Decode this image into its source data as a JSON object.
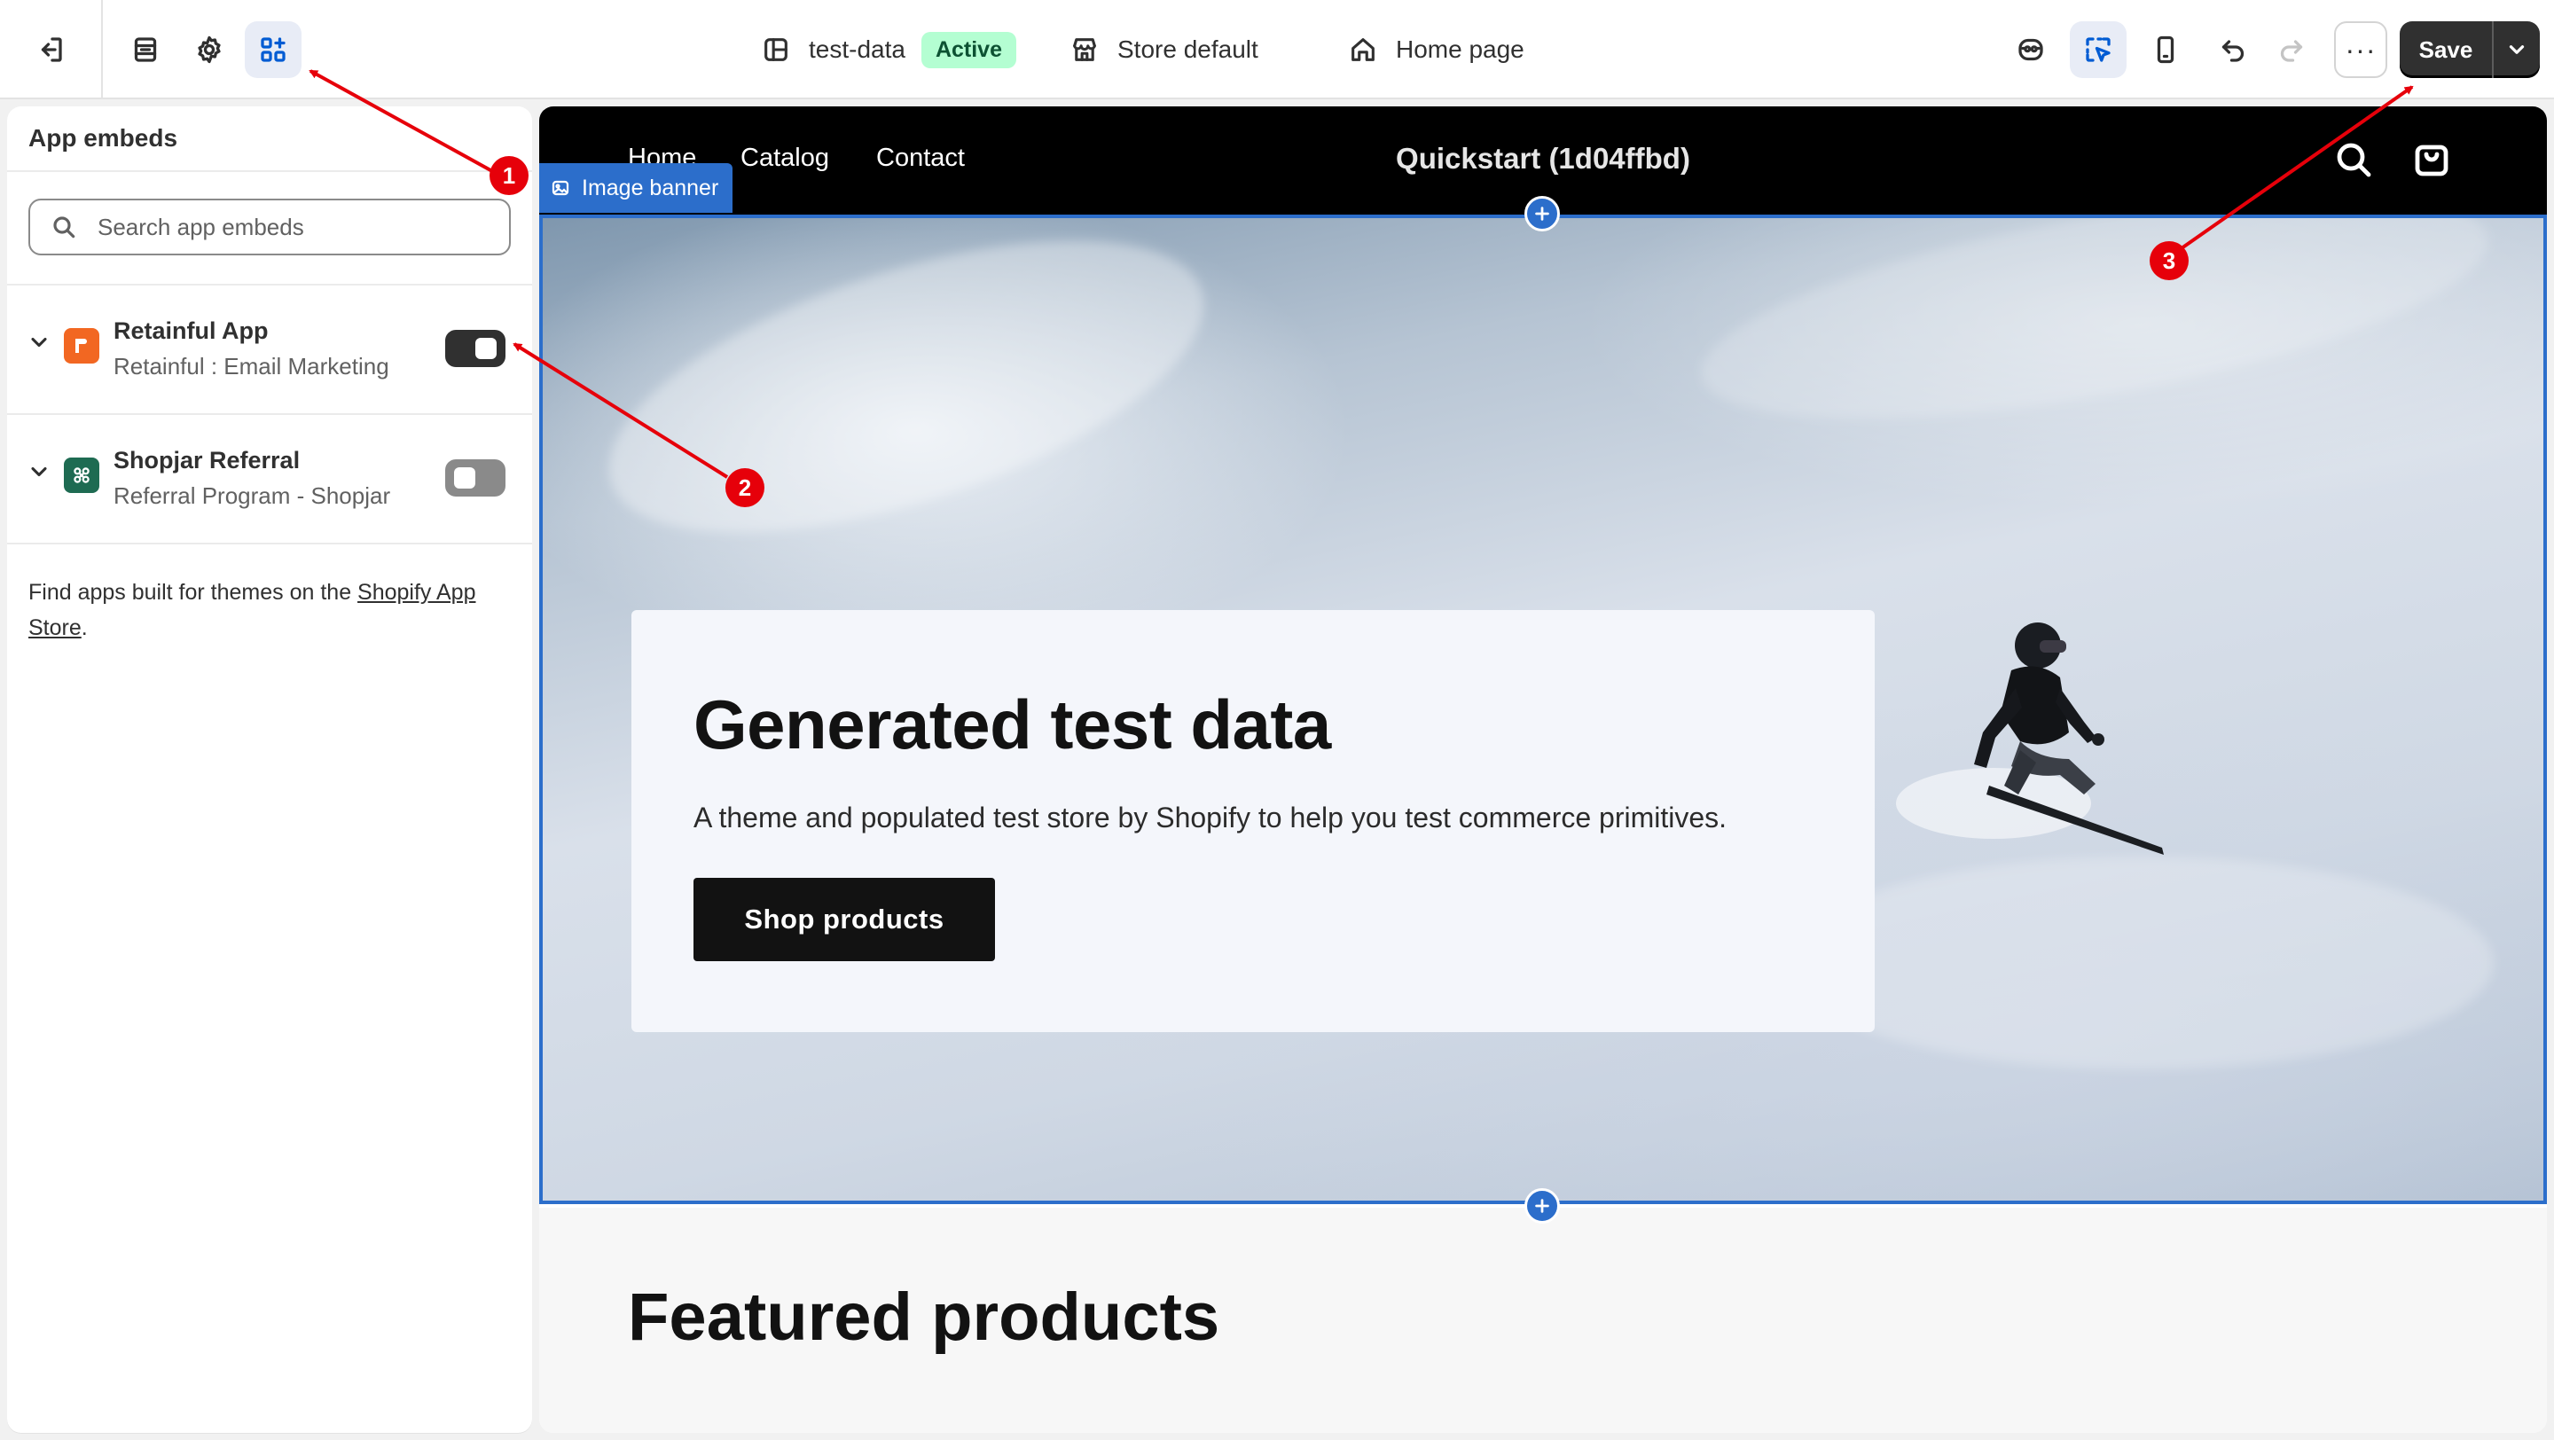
{
  "topbar": {
    "theme_name": "test-data",
    "theme_status": "Active",
    "store_context": "Store default",
    "page_template": "Home page",
    "save_label": "Save",
    "more_label": "···"
  },
  "sidebar": {
    "title": "App embeds",
    "search_placeholder": "Search app embeds",
    "apps": [
      {
        "name": "Retainful App",
        "subtitle": "Retainful : Email Marketing",
        "enabled": true,
        "logo_color": "#f26722"
      },
      {
        "name": "Shopjar Referral",
        "subtitle": "Referral Program - Shopjar",
        "enabled": false,
        "logo_color": "#1e6b52"
      }
    ],
    "footer_text": "Find apps built for themes on the ",
    "footer_link": "Shopify App Store",
    "footer_end": "."
  },
  "preview": {
    "nav": [
      "Home",
      "Catalog",
      "Contact"
    ],
    "store_name": "Quickstart (1d04ffbd)",
    "section_tag": "Image banner",
    "hero_title": "Generated test data",
    "hero_subtitle": "A theme and populated test store by Shopify to help you test commerce primitives.",
    "hero_button": "Shop products",
    "featured_title": "Featured products"
  },
  "annotations": {
    "markers": [
      "1",
      "2",
      "3"
    ],
    "color": "#e6000a"
  },
  "colors": {
    "accent": "#2c6ecb",
    "active_badge_bg": "#b4fed2",
    "active_badge_text": "#0c5132"
  }
}
